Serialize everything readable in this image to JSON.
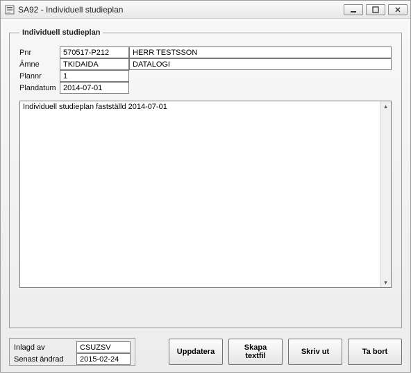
{
  "window": {
    "title": "SA92 - Individuell studieplan"
  },
  "group": {
    "legend": "Individuell studieplan"
  },
  "form": {
    "pnr_label": "Pnr",
    "pnr_value": "570517-P212",
    "name_value": "HERR TESTSSON",
    "amne_label": "Ämne",
    "amne_code": "TKIDAIDA",
    "amne_name": "DATALOGI",
    "plannr_label": "Plannr",
    "plannr_value": "1",
    "plandatum_label": "Plandatum",
    "plandatum_value": "2014-07-01"
  },
  "notes": {
    "text": "Individuell studieplan fastställd 2014-07-01"
  },
  "meta": {
    "inlagd_label": "Inlagd av",
    "inlagd_value": "CSUZSV",
    "senast_label": "Senast ändrad",
    "senast_value": "2015-02-24"
  },
  "buttons": {
    "uppdatera": "Uppdatera",
    "skapa": "Skapa\ntextfil",
    "skrivut": "Skriv ut",
    "tabort": "Ta bort"
  }
}
